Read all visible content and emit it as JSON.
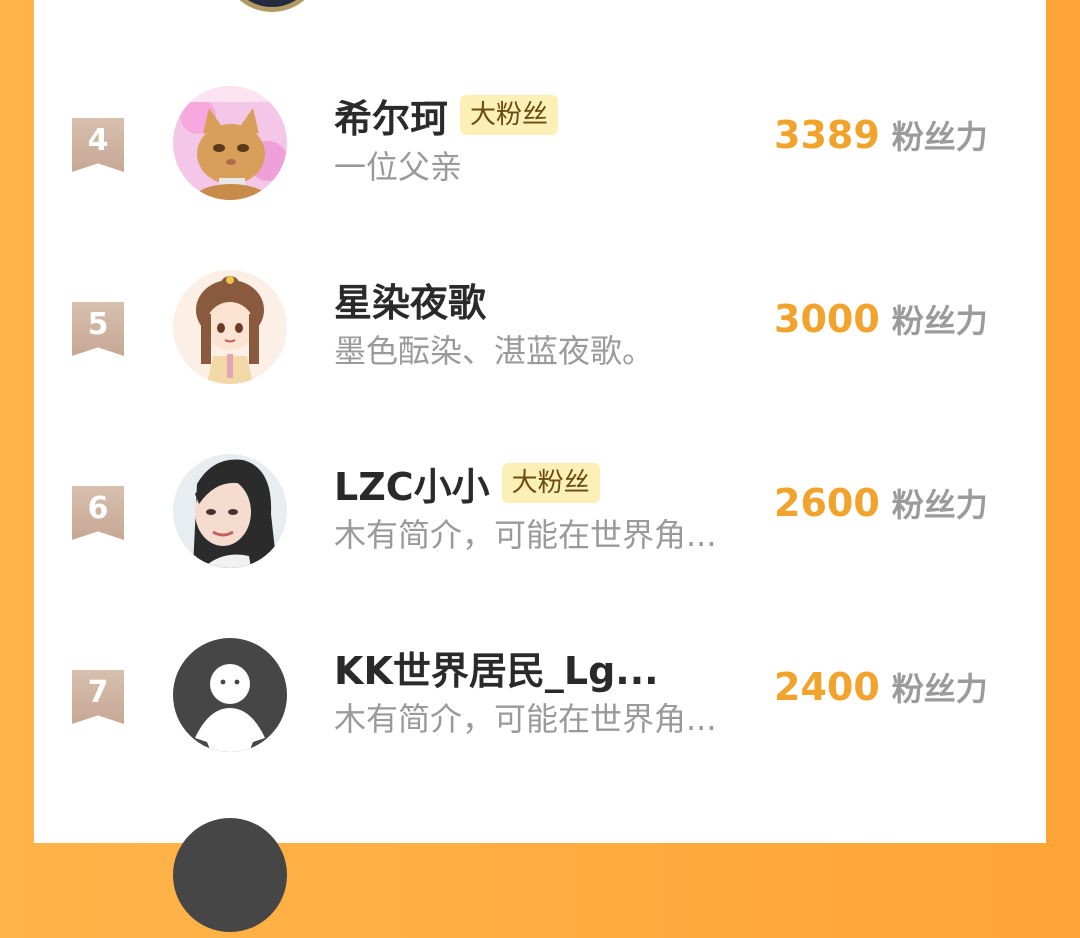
{
  "rows": [
    {
      "rank": "4",
      "name": "希尔珂",
      "tag": "大粉丝",
      "bio": "一位父亲",
      "score": "3389",
      "score_unit": "粉丝力",
      "avatar": "cat-avatar"
    },
    {
      "rank": "5",
      "name": "星染夜歌",
      "tag": "",
      "bio": "墨色酝染、湛蓝夜歌。",
      "score": "3000",
      "score_unit": "粉丝力",
      "avatar": "anime-girl-avatar"
    },
    {
      "rank": "6",
      "name": "LZC小小",
      "tag": "大粉丝",
      "bio": "木有简介，可能在世界角...",
      "score": "2600",
      "score_unit": "粉丝力",
      "avatar": "portrait-avatar"
    },
    {
      "rank": "7",
      "name": "KK世界居民_Lg...",
      "tag": "",
      "bio": "木有简介，可能在世界角...",
      "score": "2400",
      "score_unit": "粉丝力",
      "avatar": "default-user-avatar"
    }
  ],
  "colors": {
    "accent": "#f2a32c",
    "frame": "#ffa436",
    "badge": "#c6a894"
  }
}
